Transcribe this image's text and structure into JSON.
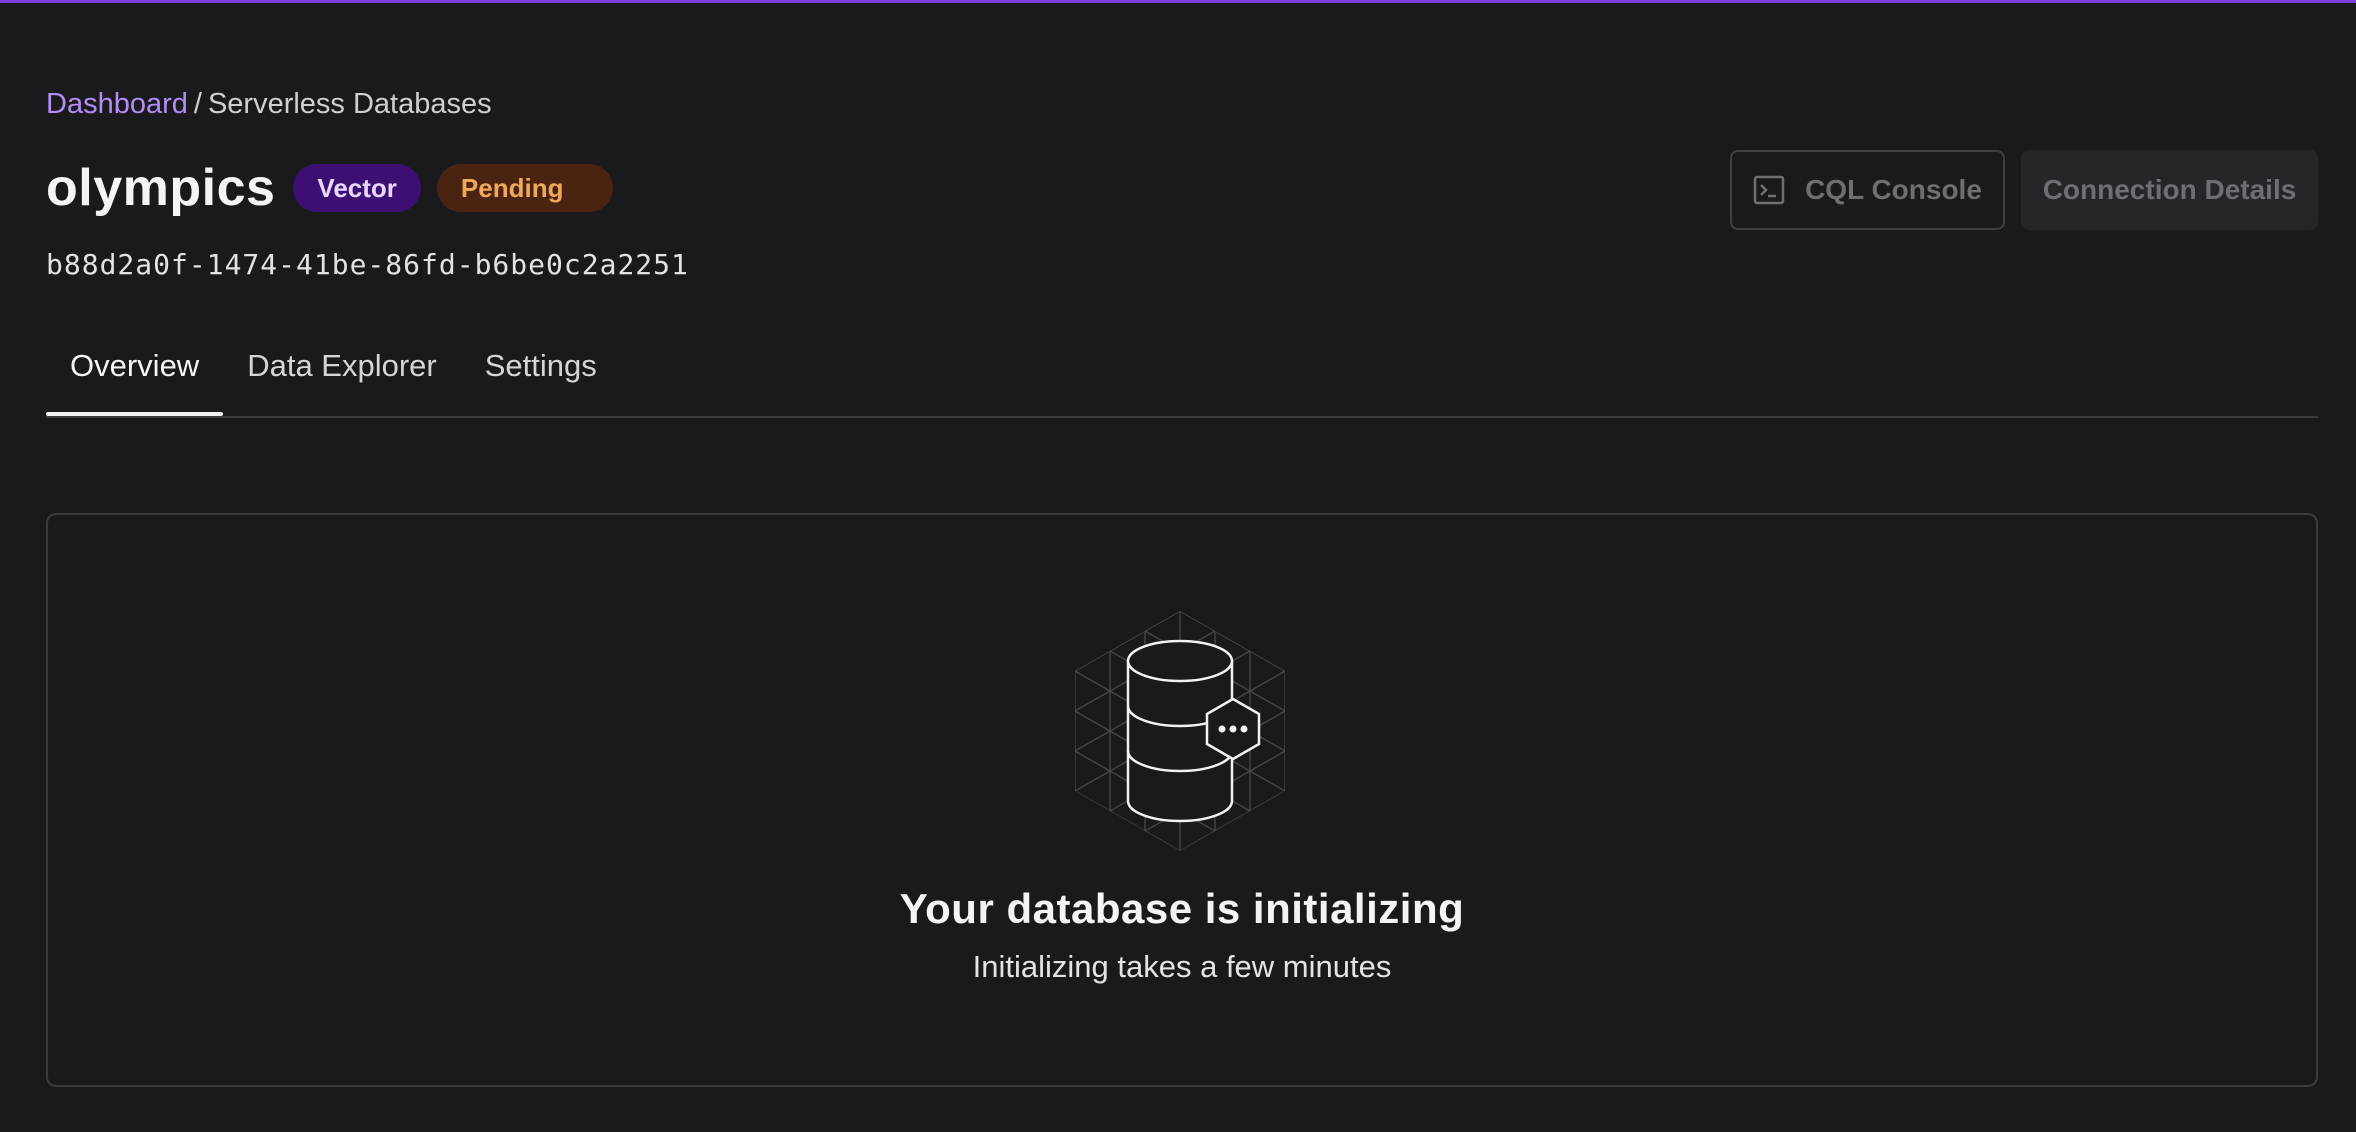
{
  "breadcrumb": {
    "root": "Dashboard",
    "separator": "/",
    "current": "Serverless Databases"
  },
  "database": {
    "name": "olympics",
    "badges": {
      "type": "Vector",
      "status": "Pending"
    },
    "id": "b88d2a0f-1474-41be-86fd-b6be0c2a2251"
  },
  "actions": {
    "console_label": "CQL Console",
    "console_icon": "terminal-icon",
    "connection_label": "Connection Details"
  },
  "tabs": [
    {
      "label": "Overview",
      "active": true
    },
    {
      "label": "Data Explorer",
      "active": false
    },
    {
      "label": "Settings",
      "active": false
    }
  ],
  "status_card": {
    "icon": "database-pending-icon",
    "title": "Your database is initializing",
    "subtitle": "Initializing takes a few minutes"
  },
  "colors": {
    "accent": "#7b3fe4",
    "link": "#b38cf5",
    "vector_badge_bg": "#3d0f73",
    "pending_badge_bg": "#4a2411",
    "pending_badge_text": "#f0a95a",
    "background": "#1a1a1c"
  }
}
